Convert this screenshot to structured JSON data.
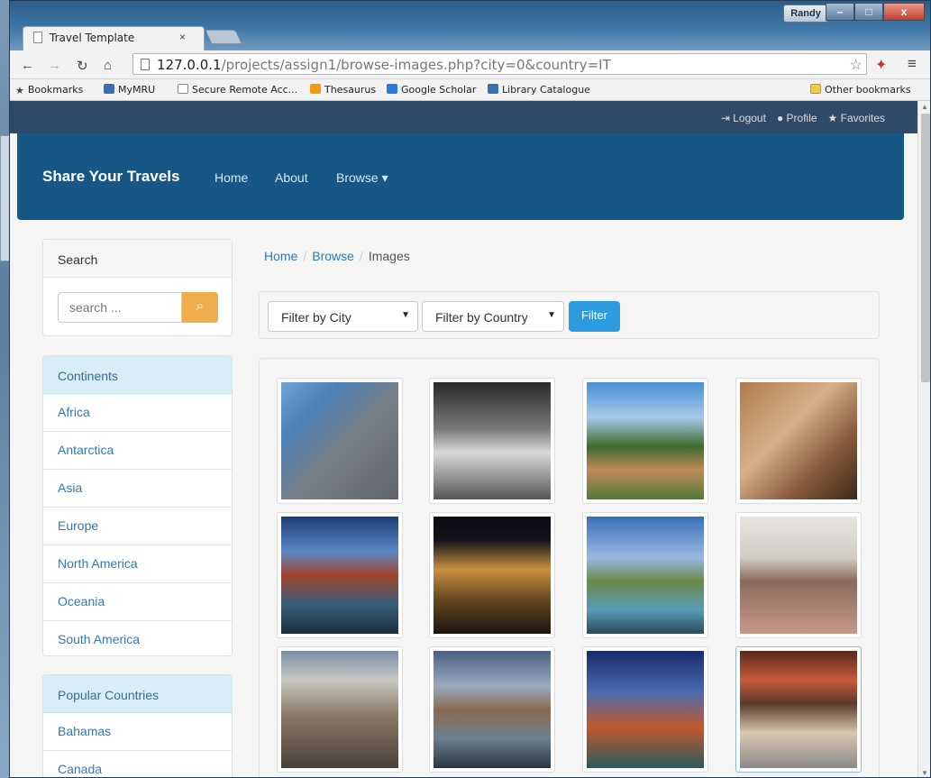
{
  "browser": {
    "tab_title": "Travel Template",
    "tab_close": "×",
    "user": "Randy",
    "window_buttons": [
      "–",
      "□",
      "x"
    ],
    "url_host": "127.0.0.1",
    "url_path": "/projects/assign1/browse-images.php?city=0&country=IT",
    "bookmarks": [
      "Bookmarks",
      "MyMRU",
      "Secure Remote Acc...",
      "Thesaurus",
      "Google Scholar",
      "Library Catalogue"
    ],
    "other_bookmarks": "Other bookmarks"
  },
  "topbar": {
    "logout": "Logout",
    "profile": "Profile",
    "favorites": "Favorites"
  },
  "navbar": {
    "brand": "Share Your Travels",
    "home": "Home",
    "about": "About",
    "browse": "Browse ▾"
  },
  "sidebar": {
    "search_title": "Search",
    "search_placeholder": "search ...",
    "continents_title": "Continents",
    "continents": [
      "Africa",
      "Antarctica",
      "Asia",
      "Europe",
      "North America",
      "Oceania",
      "South America"
    ],
    "countries_title": "Popular Countries",
    "countries": [
      "Bahamas",
      "Canada"
    ]
  },
  "breadcrumb": {
    "home": "Home",
    "browse": "Browse",
    "current": "Images"
  },
  "filters": {
    "city": "Filter by City",
    "country": "Filter by Country",
    "button": "Filter"
  },
  "accent_colors": {
    "navbar": "#175785",
    "link": "#3079b5",
    "search_button": "#f0ad4e",
    "filter_button": "#2d9bdf"
  }
}
